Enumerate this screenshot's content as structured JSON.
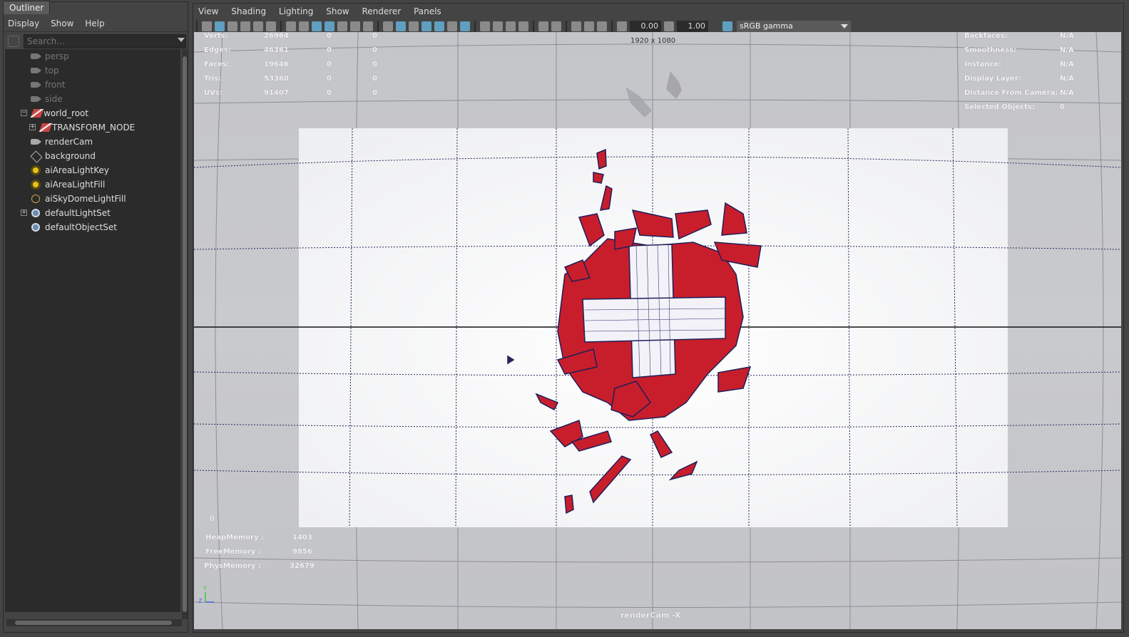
{
  "outliner": {
    "tab": "Outliner",
    "menu": [
      "Display",
      "Show",
      "Help"
    ],
    "search_placeholder": "Search...",
    "items": [
      {
        "label": "persp",
        "icon": "camera-icon"
      },
      {
        "label": "top",
        "icon": "camera-icon"
      },
      {
        "label": "front",
        "icon": "camera-icon"
      },
      {
        "label": "side",
        "icon": "camera-icon"
      },
      {
        "label": "world_root",
        "icon": "transform-icon"
      },
      {
        "label": "TRANSFORM_NODE",
        "icon": "transform-icon"
      },
      {
        "label": "renderCam",
        "icon": "camera-icon"
      },
      {
        "label": "background",
        "icon": "mesh-icon"
      },
      {
        "label": "aiAreaLightKey",
        "icon": "area-light-icon"
      },
      {
        "label": "aiAreaLightFill",
        "icon": "area-light-icon"
      },
      {
        "label": "aiSkyDomeLightFill",
        "icon": "skydome-light-icon"
      },
      {
        "label": "defaultLightSet",
        "icon": "set-icon"
      },
      {
        "label": "defaultObjectSet",
        "icon": "set-icon"
      }
    ]
  },
  "viewport": {
    "menu": [
      "View",
      "Shading",
      "Lighting",
      "Show",
      "Renderer",
      "Panels"
    ],
    "exposure": "0.00",
    "gamma": "1.00",
    "color_space": "sRGB gamma",
    "resolution": "1920 x 1080",
    "camera_label": "renderCam -X",
    "frame": "0",
    "stats": {
      "verts": {
        "label": "Verts:",
        "values": [
          "26964",
          "0",
          "0"
        ]
      },
      "edges": {
        "label": "Edges:",
        "values": [
          "46361",
          "0",
          "0"
        ]
      },
      "faces": {
        "label": "Faces:",
        "values": [
          "19646",
          "0",
          "0"
        ]
      },
      "tris": {
        "label": "Tris:",
        "values": [
          "53360",
          "0",
          "0"
        ]
      },
      "uvs": {
        "label": "UVs:",
        "values": [
          "91407",
          "0",
          "0"
        ]
      }
    },
    "info": [
      {
        "label": "Backfaces:",
        "value": "N/A"
      },
      {
        "label": "Smoothness:",
        "value": "N/A"
      },
      {
        "label": "Instance:",
        "value": "N/A"
      },
      {
        "label": "Display Layer:",
        "value": "N/A"
      },
      {
        "label": "Distance From Camera:",
        "value": "N/A"
      },
      {
        "label": "Selected Objects:",
        "value": "0"
      }
    ],
    "memory": [
      {
        "label": "HeapMemory :",
        "value": "1403"
      },
      {
        "label": "FreeMemory :",
        "value": "9856"
      },
      {
        "label": "PhysMemory :",
        "value": "32679"
      }
    ],
    "axis_labels": {
      "y": "Y",
      "z": "Z"
    }
  }
}
